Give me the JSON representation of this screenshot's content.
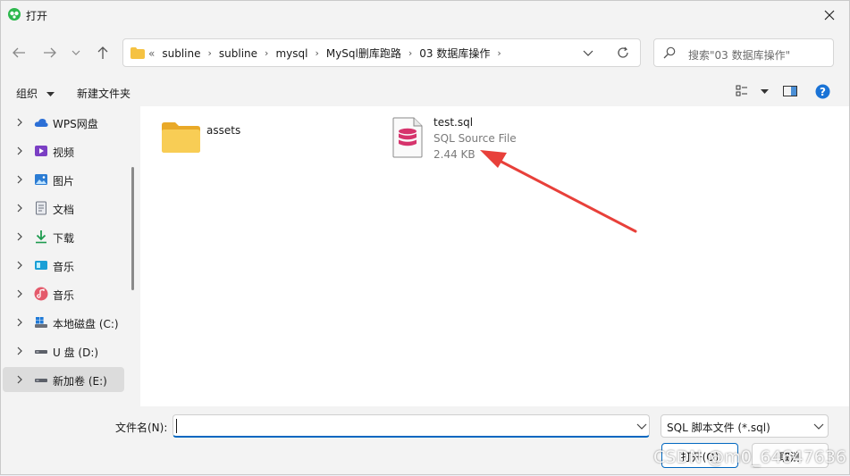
{
  "window": {
    "title": "打开",
    "close": "✕"
  },
  "nav": {
    "back": "←",
    "forward": "→",
    "recent": "⌄",
    "up": "↑",
    "breadcrumb_prefix": "«",
    "breadcrumbs": [
      "subline",
      "subline",
      "mysql",
      "MySql删库跑路",
      "03 数据库操作"
    ],
    "search_placeholder": "搜索\"03 数据库操作\""
  },
  "commands": {
    "organize": "组织",
    "new_folder": "新建文件夹",
    "help": "?"
  },
  "sidebar": {
    "items": [
      {
        "label": "WPS网盘",
        "icon": "cloud-icon"
      },
      {
        "label": "视频",
        "icon": "video-icon"
      },
      {
        "label": "图片",
        "icon": "picture-icon"
      },
      {
        "label": "文档",
        "icon": "document-icon"
      },
      {
        "label": "下载",
        "icon": "download-icon"
      },
      {
        "label": "音乐",
        "icon": "music-app-icon"
      },
      {
        "label": "音乐",
        "icon": "music-icon"
      },
      {
        "label": "本地磁盘 (C:)",
        "icon": "windows-drive-icon"
      },
      {
        "label": "U 盘 (D:)",
        "icon": "usb-drive-icon"
      },
      {
        "label": "新加卷 (E:)",
        "icon": "drive-icon",
        "selected": true
      }
    ]
  },
  "files": [
    {
      "name": "assets",
      "icon": "folder-icon"
    },
    {
      "name": "test.sql",
      "type": "SQL Source File",
      "size": "2.44 KB",
      "icon": "sql-file-icon"
    }
  ],
  "footer": {
    "filename_label": "文件名(N):",
    "filename_value": "",
    "filetype": "SQL 脚本文件 (*.sql)",
    "open_button": "打开(O)",
    "cancel_button": "取消"
  },
  "watermark": "CSDN @m0_64647636",
  "colors": {
    "accent": "#0067c0",
    "arrow": "#e8403a",
    "sql_icon": "#d6336c",
    "folder": "#f5c242"
  }
}
